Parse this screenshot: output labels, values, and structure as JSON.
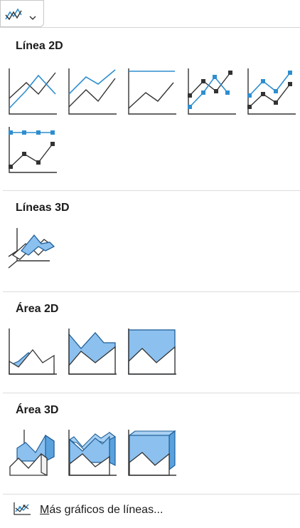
{
  "button": {
    "icon": "line-chart-icon",
    "dropdown_icon": "chevron-down-icon"
  },
  "sections": {
    "line_2d": {
      "title": "Línea 2D"
    },
    "line_3d": {
      "title": "Líneas 3D"
    },
    "area_2d": {
      "title": "Área 2D"
    },
    "area_3d": {
      "title": "Área 3D"
    }
  },
  "more": {
    "icon": "line-chart-icon",
    "label_first": "M",
    "label_rest": "ás gráficos de líneas..."
  },
  "colors": {
    "accent": "#2e8ecf",
    "area_fill": "#8cc0ee",
    "dark": "#333333"
  }
}
